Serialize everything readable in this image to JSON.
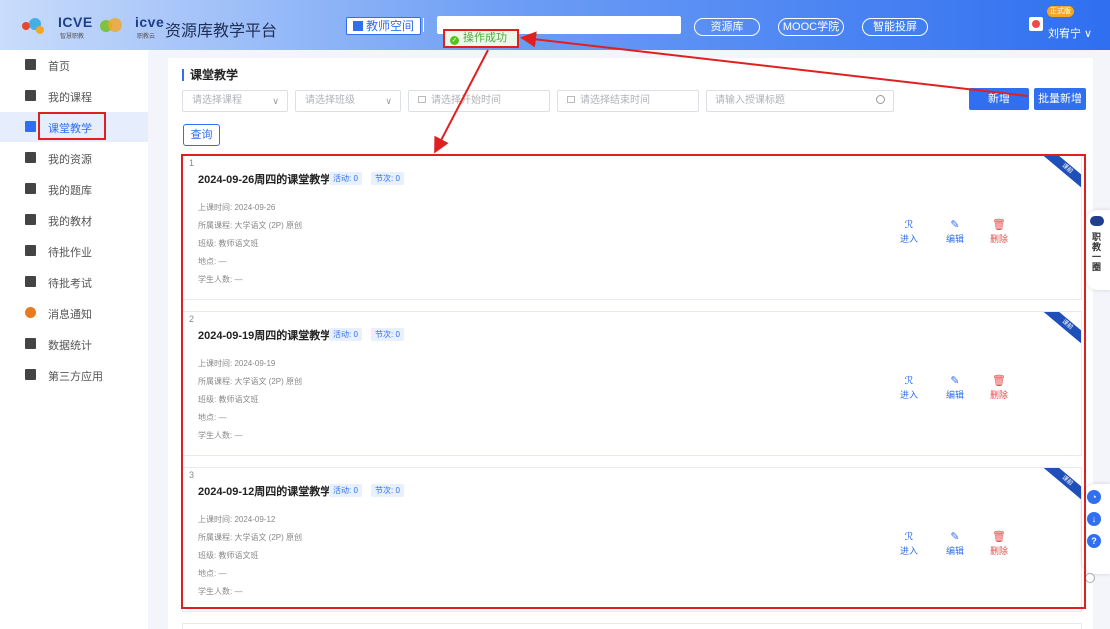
{
  "header": {
    "logo1_text": "ICVE",
    "logo1_sub": "智慧职教",
    "logo2_text": "icve",
    "logo2_sub": "职教云",
    "platform_title": "资源库教学平台",
    "teacher_space": "教师空间",
    "nav": [
      "资源库",
      "MOOC学院",
      "智能投屏"
    ],
    "user_badge": "正式版",
    "user_name": "刘宥宁 ∨"
  },
  "toast": {
    "text": "操作成功"
  },
  "sidebar": {
    "items": [
      {
        "label": "首页",
        "icon": "home-icon"
      },
      {
        "label": "我的课程",
        "icon": "course-icon"
      },
      {
        "label": "课堂教学",
        "icon": "class-teaching-icon",
        "active": true
      },
      {
        "label": "我的资源",
        "icon": "resource-icon"
      },
      {
        "label": "我的题库",
        "icon": "question-bank-icon"
      },
      {
        "label": "我的教材",
        "icon": "textbook-icon"
      },
      {
        "label": "待批作业",
        "icon": "homework-icon"
      },
      {
        "label": "待批考试",
        "icon": "exam-icon"
      },
      {
        "label": "消息通知",
        "icon": "notification-icon"
      },
      {
        "label": "数据统计",
        "icon": "statistics-icon"
      },
      {
        "label": "第三方应用",
        "icon": "apps-icon"
      }
    ]
  },
  "main": {
    "title": "课堂教学",
    "filters": {
      "course_placeholder": "请选择课程",
      "class_placeholder": "请选择班级",
      "start_placeholder": "请选择开始时间",
      "end_placeholder": "请选择结束时间",
      "title_placeholder": "请输入授课标题"
    },
    "add_label": "新增",
    "batch_add_label": "批量新增",
    "query_label": "查询",
    "cards": [
      {
        "num": "1",
        "title": "2024-09-26周四的课堂教学",
        "activity": "活动: 0",
        "session": "节次: 0",
        "time": "上课时间: 2024-09-26",
        "course": "所属课程: 大学语文 (2P) 原创",
        "class": "班级: 教师语文班",
        "place": "地点: —",
        "students": "学生人数: —",
        "ribbon": "课前"
      },
      {
        "num": "2",
        "title": "2024-09-19周四的课堂教学",
        "activity": "活动: 0",
        "session": "节次: 0",
        "time": "上课时间: 2024-09-19",
        "course": "所属课程: 大学语文 (2P) 原创",
        "class": "班级: 教师语文班",
        "place": "地点: —",
        "students": "学生人数: —",
        "ribbon": "课前"
      },
      {
        "num": "3",
        "title": "2024-09-12周四的课堂教学",
        "activity": "活动: 0",
        "session": "节次: 0",
        "time": "上课时间: 2024-09-12",
        "course": "所属课程: 大学语文 (2P) 原创",
        "class": "班级: 教师语文班",
        "place": "地点: —",
        "students": "学生人数: —",
        "ribbon": "课前"
      }
    ],
    "actions": {
      "enter": "进入",
      "edit": "编辑",
      "delete": "删除"
    }
  },
  "float": {
    "label": "职教一圈"
  },
  "colors": {
    "primary": "#2f6ff0",
    "danger": "#e84b4b",
    "annotation": "#e02020",
    "success": "#52c41a"
  }
}
